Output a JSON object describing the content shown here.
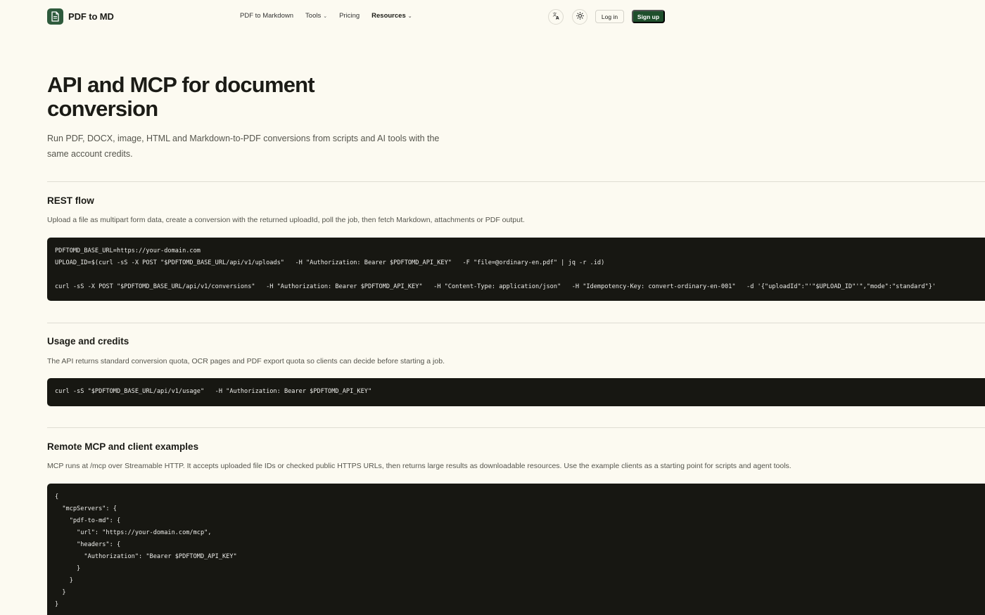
{
  "header": {
    "logo_text": "PDF to MD",
    "nav": [
      {
        "label": "PDF to Markdown"
      },
      {
        "label": "Tools"
      },
      {
        "label": "Pricing"
      },
      {
        "label": "Resources"
      }
    ],
    "login_label": "Log in",
    "signup_label": "Sign up"
  },
  "hero": {
    "title": "API and MCP for document conversion",
    "subtitle": "Run PDF, DOCX, image, HTML and Markdown-to-PDF conversions from scripts and AI tools with the same account credits."
  },
  "sections": [
    {
      "title": "REST flow",
      "description": "Upload a file as multipart form data, create a conversion with the returned uploadId, poll the job, then fetch Markdown, attachments or PDF output.",
      "code": "PDFTOMD_BASE_URL=https://your-domain.com\nUPLOAD_ID=$(curl -sS -X POST \"$PDFTOMD_BASE_URL/api/v1/uploads\"   -H \"Authorization: Bearer $PDFTOMD_API_KEY\"   -F \"file=@ordinary-en.pdf\" | jq -r .id)\n\ncurl -sS -X POST \"$PDFTOMD_BASE_URL/api/v1/conversions\"   -H \"Authorization: Bearer $PDFTOMD_API_KEY\"   -H \"Content-Type: application/json\"   -H \"Idempotency-Key: convert-ordinary-en-001\"   -d '{\"uploadId\":\"'\"$UPLOAD_ID\"'\",\"mode\":\"standard\"}'"
    },
    {
      "title": "Usage and credits",
      "description": "The API returns standard conversion quota, OCR pages and PDF export quota so clients can decide before starting a job.",
      "code": "curl -sS \"$PDFTOMD_BASE_URL/api/v1/usage\"   -H \"Authorization: Bearer $PDFTOMD_API_KEY\""
    },
    {
      "title": "Remote MCP and client examples",
      "description": "MCP runs at /mcp over Streamable HTTP. It accepts uploaded file IDs or checked public HTTPS URLs, then returns large results as downloadable resources. Use the example clients as a starting point for scripts and agent tools.",
      "code": "{\n  \"mcpServers\": {\n    \"pdf-to-md\": {\n      \"url\": \"https://your-domain.com/mcp\",\n      \"headers\": {\n        \"Authorization\": \"Bearer $PDFTOMD_API_KEY\"\n      }\n    }\n  }\n}"
    }
  ],
  "colors": {
    "background": "#fcfaf1",
    "brand": "#2e5a3c",
    "signup": "#1f4f2c",
    "code_bg": "#171712"
  },
  "icons": [
    "document-icon",
    "translate-icon",
    "sun-icon",
    "chevron-down-icon"
  ]
}
